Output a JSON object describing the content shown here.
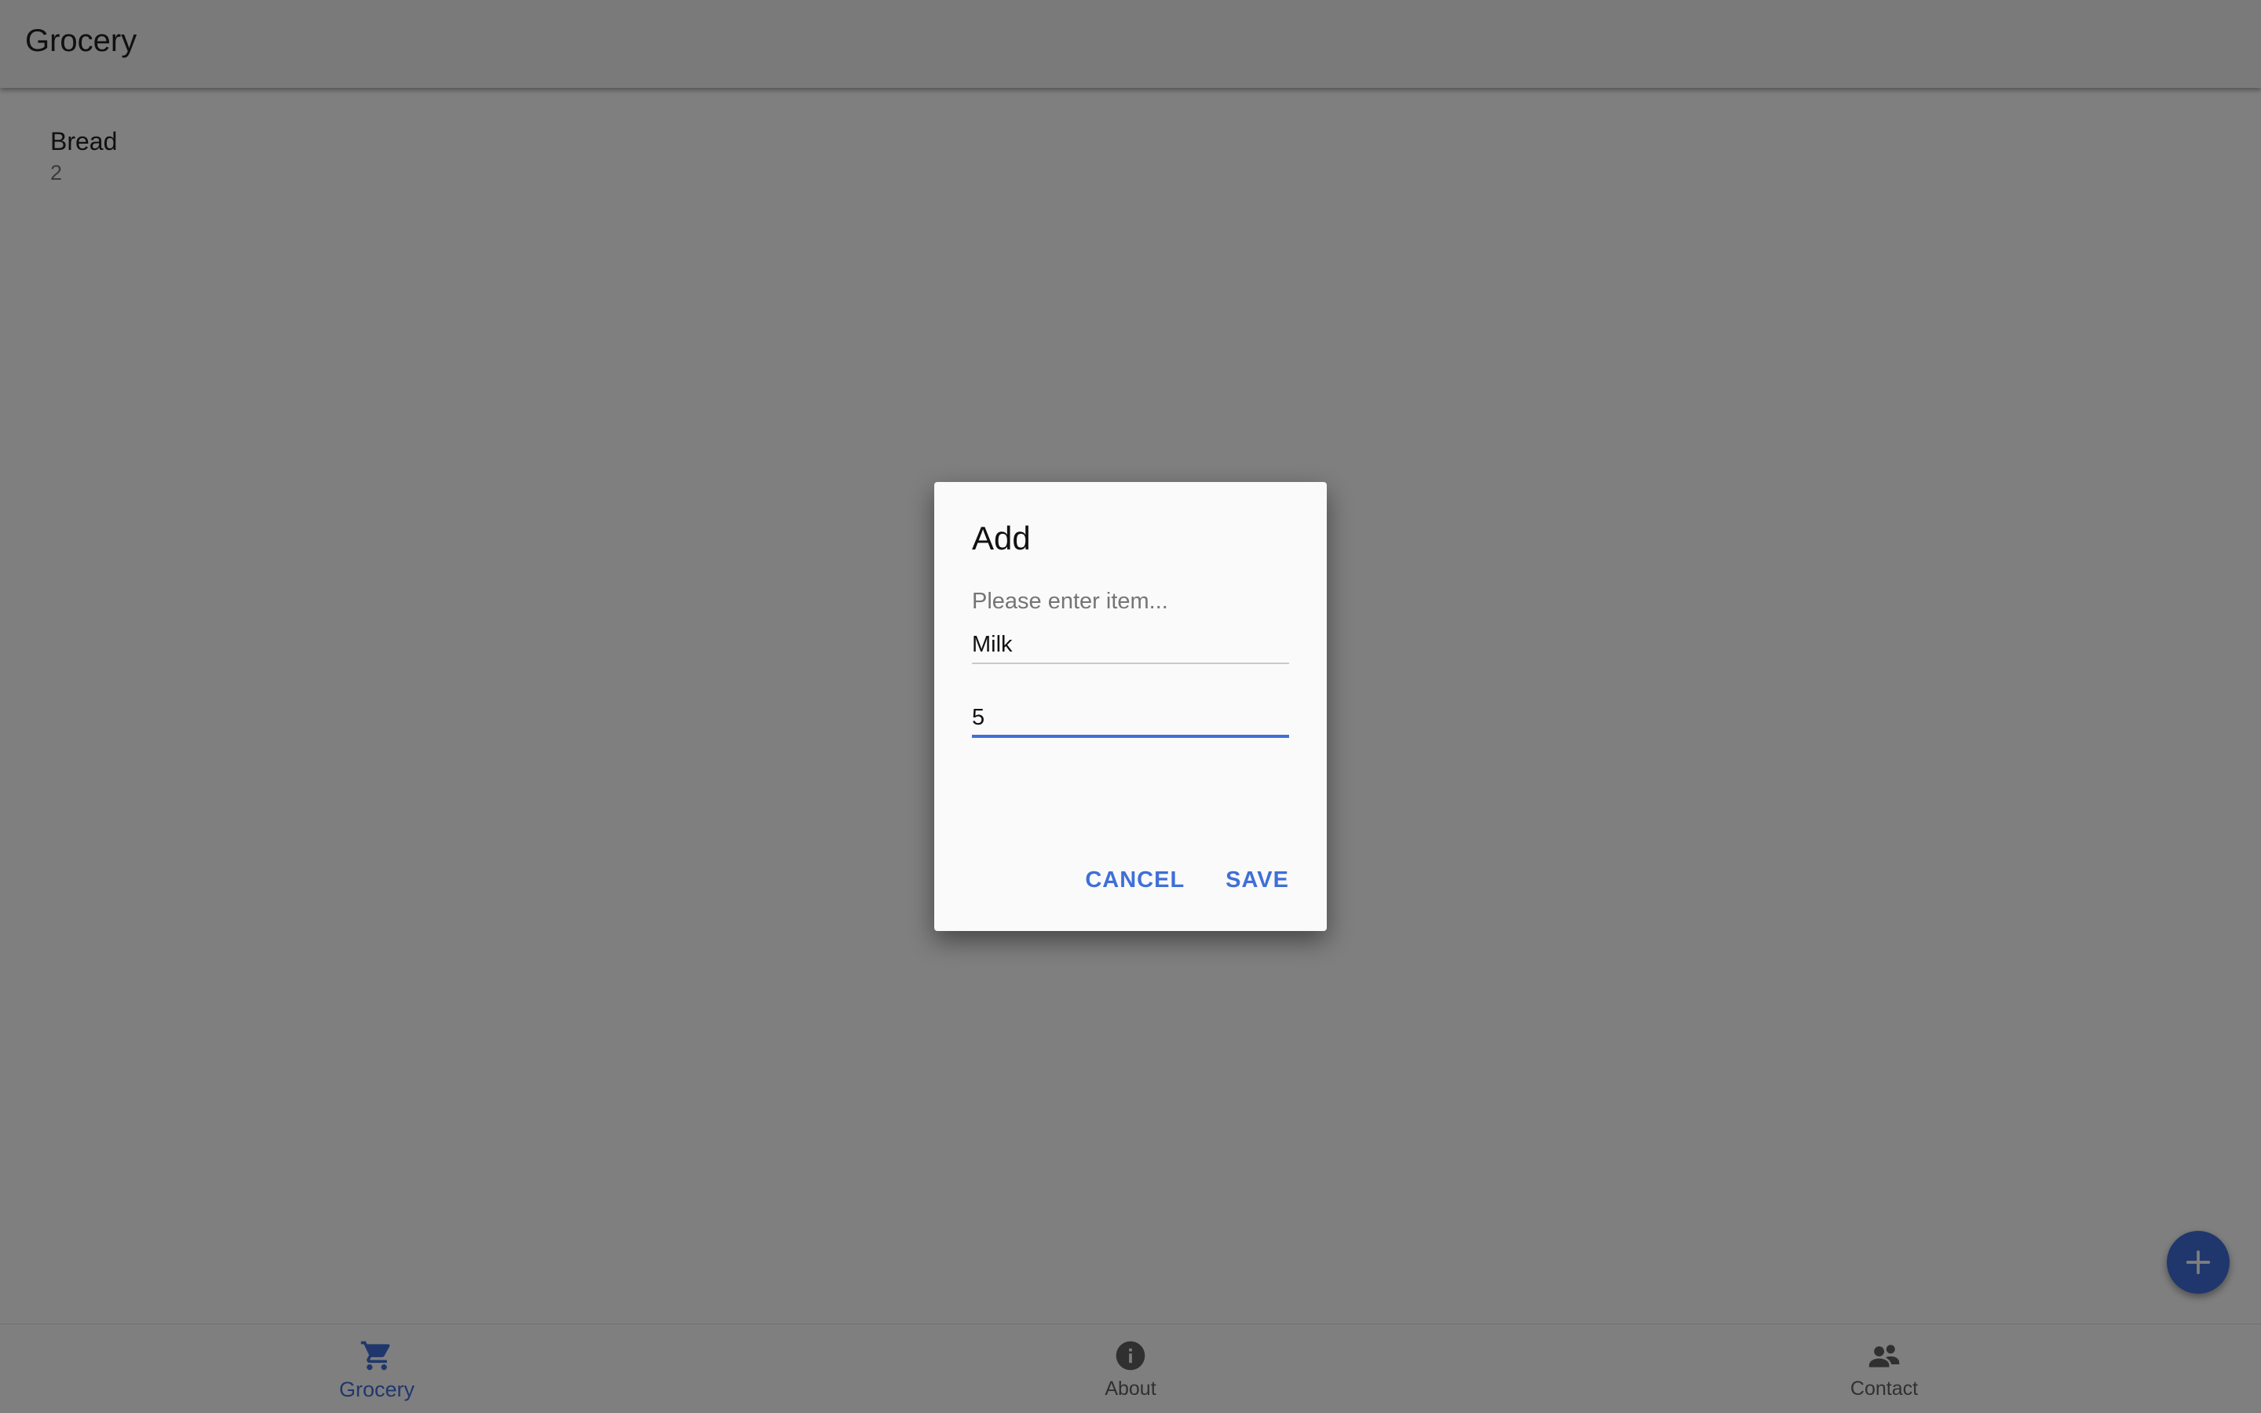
{
  "appbar": {
    "title": "Grocery"
  },
  "grocery_list": [
    {
      "name": "Bread",
      "quantity": "2"
    }
  ],
  "dialog": {
    "title": "Add",
    "message": "Please enter item...",
    "fields": {
      "item_value": "Milk",
      "quantity_value": "5"
    },
    "cancel_label": "CANCEL",
    "save_label": "SAVE"
  },
  "fab": {
    "icon": "plus-icon"
  },
  "bottom_nav": {
    "items": [
      {
        "label": "Grocery",
        "icon": "shopping-cart-icon",
        "active": true
      },
      {
        "label": "About",
        "icon": "info-icon",
        "active": false
      },
      {
        "label": "Contact",
        "icon": "people-icon",
        "active": false
      }
    ]
  },
  "colors": {
    "accent": "#3f6fd8",
    "scrim": "rgba(0,0,0,0.5)",
    "appbar_bg": "#f5f5f5",
    "dialog_bg": "#fafafa"
  }
}
